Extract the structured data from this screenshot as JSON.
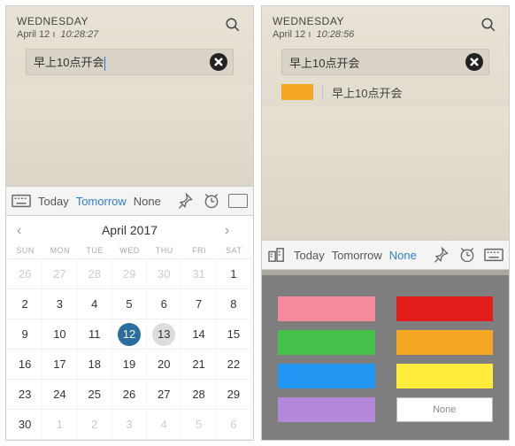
{
  "left": {
    "header": {
      "day": "WEDNESDAY",
      "date": "April 12",
      "time": "10:28:27"
    },
    "input": {
      "text": "早上10点开会"
    },
    "toolbar": {
      "today": "Today",
      "tomorrow": "Tomorrow",
      "none": "None"
    },
    "calendar": {
      "title": "April 2017",
      "dow": [
        "SUN",
        "MON",
        "TUE",
        "WED",
        "THU",
        "FRI",
        "SAT"
      ],
      "days": [
        {
          "n": 26,
          "o": true
        },
        {
          "n": 27,
          "o": true
        },
        {
          "n": 28,
          "o": true
        },
        {
          "n": 29,
          "o": true
        },
        {
          "n": 30,
          "o": true
        },
        {
          "n": 31,
          "o": true
        },
        {
          "n": 1
        },
        {
          "n": 2
        },
        {
          "n": 3
        },
        {
          "n": 4
        },
        {
          "n": 5
        },
        {
          "n": 6
        },
        {
          "n": 7
        },
        {
          "n": 8
        },
        {
          "n": 9
        },
        {
          "n": 10
        },
        {
          "n": 11
        },
        {
          "n": 12,
          "today": true
        },
        {
          "n": 13,
          "picked": true
        },
        {
          "n": 14
        },
        {
          "n": 15
        },
        {
          "n": 16
        },
        {
          "n": 17
        },
        {
          "n": 18
        },
        {
          "n": 19
        },
        {
          "n": 20
        },
        {
          "n": 21
        },
        {
          "n": 22
        },
        {
          "n": 23
        },
        {
          "n": 24
        },
        {
          "n": 25
        },
        {
          "n": 26
        },
        {
          "n": 27
        },
        {
          "n": 28
        },
        {
          "n": 29
        },
        {
          "n": 30
        },
        {
          "n": 1,
          "o": true
        },
        {
          "n": 2,
          "o": true
        },
        {
          "n": 3,
          "o": true
        },
        {
          "n": 4,
          "o": true
        },
        {
          "n": 5,
          "o": true
        },
        {
          "n": 6,
          "o": true
        }
      ]
    }
  },
  "right": {
    "header": {
      "day": "WEDNESDAY",
      "date": "April 12",
      "time": "10:28:56"
    },
    "input": {
      "text": "早上10点开会"
    },
    "result": {
      "text": "早上10点开会",
      "color": "#f5a623"
    },
    "toolbar": {
      "today": "Today",
      "tomorrow": "Tomorrow",
      "none": "None"
    },
    "colors": [
      "#f48a9a",
      "#e21b1b",
      "#45c14a",
      "#f5a623",
      "#2196f3",
      "#ffeb3b",
      "#b388d9",
      null
    ],
    "none_label": "None"
  }
}
